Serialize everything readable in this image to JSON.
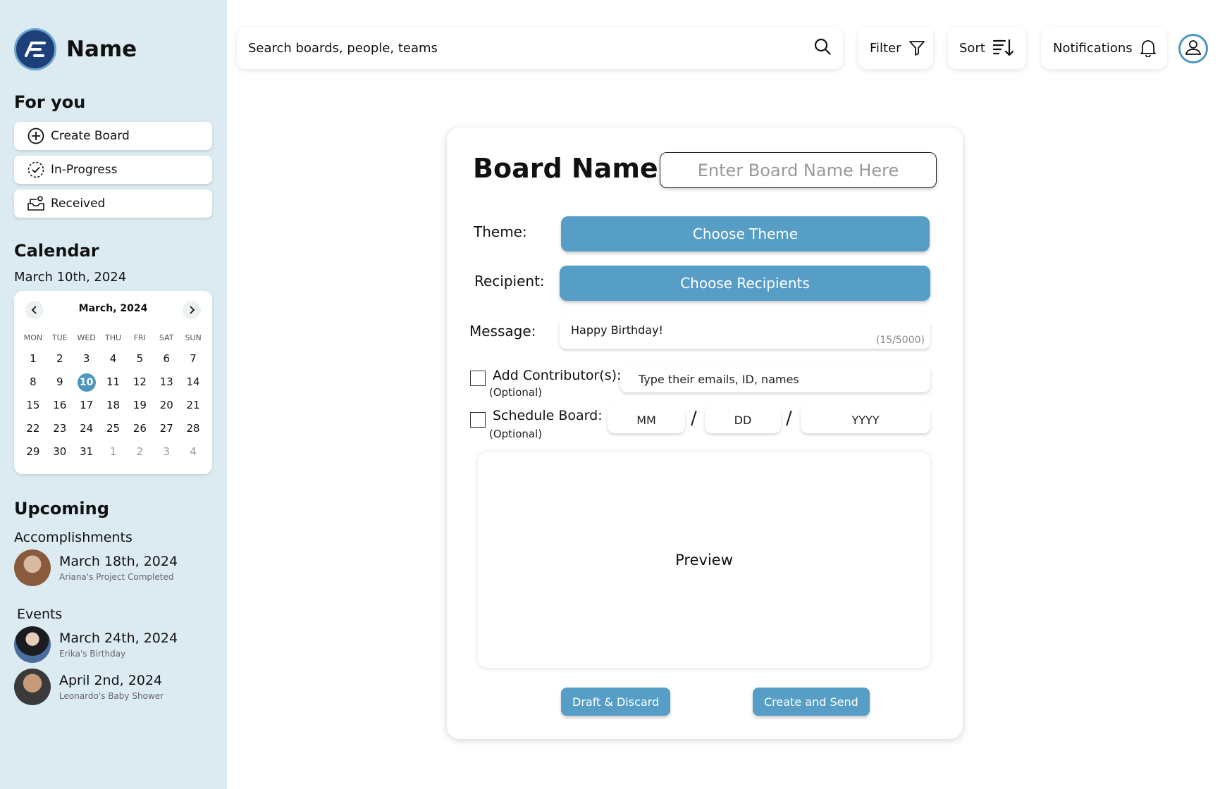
{
  "brand": {
    "name": "Name"
  },
  "sidebar": {
    "for_you_title": "For you",
    "items": [
      {
        "label": "Create Board",
        "icon": "plus-circle-icon"
      },
      {
        "label": "In-Progress",
        "icon": "dashed-check-icon"
      },
      {
        "label": "Received",
        "icon": "received-icon"
      }
    ],
    "calendar_title": "Calendar",
    "calendar_date": "March 10th, 2024",
    "calendar": {
      "month": "March, 2024",
      "days_of_week": [
        "MON",
        "TUE",
        "WED",
        "THU",
        "FRI",
        "SAT",
        "SUN"
      ],
      "selected_day": "10",
      "days": [
        "1",
        "2",
        "3",
        "4",
        "5",
        "6",
        "7",
        "8",
        "9",
        "10",
        "11",
        "12",
        "13",
        "14",
        "15",
        "16",
        "17",
        "18",
        "19",
        "20",
        "21",
        "22",
        "23",
        "24",
        "25",
        "26",
        "27",
        "28",
        "29",
        "30",
        "31"
      ],
      "next_month_days": [
        "1",
        "2",
        "3",
        "4"
      ]
    },
    "upcoming_title": "Upcoming",
    "accomplishments_title": "Accomplishments",
    "accomplishments": [
      {
        "date": "March 18th, 2024",
        "desc": "Ariana's Project Completed"
      }
    ],
    "events_title": "Events",
    "events": [
      {
        "date": "March 24th, 2024",
        "desc": "Erika's Birthday"
      },
      {
        "date": "April 2nd, 2024",
        "desc": "Leonardo's Baby Shower"
      }
    ]
  },
  "topbar": {
    "search_placeholder": "Search boards, people, teams",
    "filter_label": "Filter",
    "sort_label": "Sort",
    "notifications_label": "Notifications"
  },
  "form": {
    "title": "Board Name:",
    "name_placeholder": "Enter Board Name Here",
    "theme_label": "Theme:",
    "theme_button": "Choose Theme",
    "recipient_label": "Recipient:",
    "recipient_button": "Choose Recipients",
    "message_label": "Message:",
    "message_value": "Happy Birthday!",
    "message_count": "(15/5000)",
    "contributors_label": "Add Contributor(s):",
    "contributors_optional": "(Optional)",
    "contributors_placeholder": "Type their emails, ID, names",
    "schedule_label": "Schedule Board:",
    "schedule_optional": "(Optional)",
    "mm_placeholder": "MM",
    "dd_placeholder": "DD",
    "yyyy_placeholder": "YYYY",
    "date_separator": "/",
    "preview_label": "Preview",
    "draft_button": "Draft & Discard",
    "create_button": "Create and Send"
  },
  "colors": {
    "sidebar_bg": "#dceaf2",
    "accent": "#569ec6",
    "logo_bg": "#1d3f7a"
  }
}
